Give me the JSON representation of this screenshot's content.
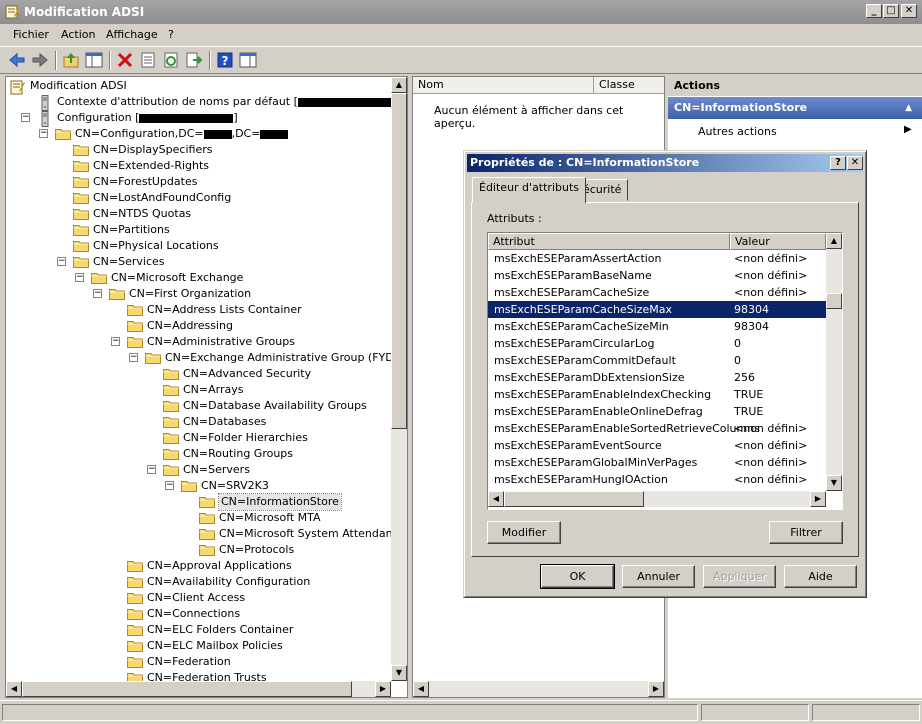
{
  "window": {
    "title": "Modification ADSI"
  },
  "menu": [
    "Fichier",
    "Action",
    "Affichage",
    "?"
  ],
  "toolbar": {
    "icons": [
      "back-icon",
      "forward-icon",
      "up-icon",
      "show-hide-console-tree-icon",
      "delete-icon",
      "properties-icon",
      "refresh-icon",
      "export-list-icon",
      "help-icon",
      "show-hide-action-pane-icon"
    ]
  },
  "tree": {
    "root": "Modification ADSI",
    "items": [
      "Contexte d'attribution de noms par défaut [",
      "Configuration [",
      "CN=Configuration,DC=",
      ",DC=",
      "CN=DisplaySpecifiers",
      "CN=Extended-Rights",
      "CN=ForestUpdates",
      "CN=LostAndFoundConfig",
      "CN=NTDS Quotas",
      "CN=Partitions",
      "CN=Physical Locations",
      "CN=Services",
      "CN=Microsoft Exchange",
      "CN=First Organization",
      "CN=Address Lists Container",
      "CN=Addressing",
      "CN=Administrative Groups",
      "CN=Exchange Administrative Group (FYDIBOHF",
      "CN=Advanced Security",
      "CN=Arrays",
      "CN=Database Availability Groups",
      "CN=Databases",
      "CN=Folder Hierarchies",
      "CN=Routing Groups",
      "CN=Servers",
      "CN=SRV2K3",
      "CN=InformationStore",
      "CN=Microsoft MTA",
      "CN=Microsoft System Attendant",
      "CN=Protocols",
      "CN=Approval Applications",
      "CN=Availability Configuration",
      "CN=Client Access",
      "CN=Connections",
      "CN=ELC Folders Container",
      "CN=ELC Mailbox Policies",
      "CN=Federation",
      "CN=Federation Trusts"
    ]
  },
  "list": {
    "col_name": "Nom",
    "col_class": "Classe",
    "empty": "Aucun élément à afficher dans cet aperçu."
  },
  "actions": {
    "header": "Actions",
    "section": "CN=InformationStore",
    "more": "Autres actions"
  },
  "dialog": {
    "title": "Propriétés de : CN=InformationStore",
    "tabs": [
      "Éditeur d'attributs",
      "Sécurité"
    ],
    "attr_label": "Attributs :",
    "col_attr": "Attribut",
    "col_value": "Valeur",
    "rows": [
      {
        "attr": "msExchESEParamAssertAction",
        "value": "<non défini>"
      },
      {
        "attr": "msExchESEParamBaseName",
        "value": "<non défini>"
      },
      {
        "attr": "msExchESEParamCacheSize",
        "value": "<non défini>"
      },
      {
        "attr": "msExchESEParamCacheSizeMax",
        "value": "98304"
      },
      {
        "attr": "msExchESEParamCacheSizeMin",
        "value": "98304"
      },
      {
        "attr": "msExchESEParamCircularLog",
        "value": "0"
      },
      {
        "attr": "msExchESEParamCommitDefault",
        "value": "0"
      },
      {
        "attr": "msExchESEParamDbExtensionSize",
        "value": "256"
      },
      {
        "attr": "msExchESEParamEnableIndexChecking",
        "value": "TRUE"
      },
      {
        "attr": "msExchESEParamEnableOnlineDefrag",
        "value": "TRUE"
      },
      {
        "attr": "msExchESEParamEnableSortedRetrieveColumns",
        "value": "<non défini>"
      },
      {
        "attr": "msExchESEParamEventSource",
        "value": "<non défini>"
      },
      {
        "attr": "msExchESEParamGlobalMinVerPages",
        "value": "<non défini>"
      },
      {
        "attr": "msExchESEParamHungIOAction",
        "value": "<non défini>"
      }
    ],
    "btn_edit": "Modifier",
    "btn_filter": "Filtrer",
    "btn_ok": "OK",
    "btn_cancel": "Annuler",
    "btn_apply": "Appliquer",
    "btn_help": "Aide"
  }
}
